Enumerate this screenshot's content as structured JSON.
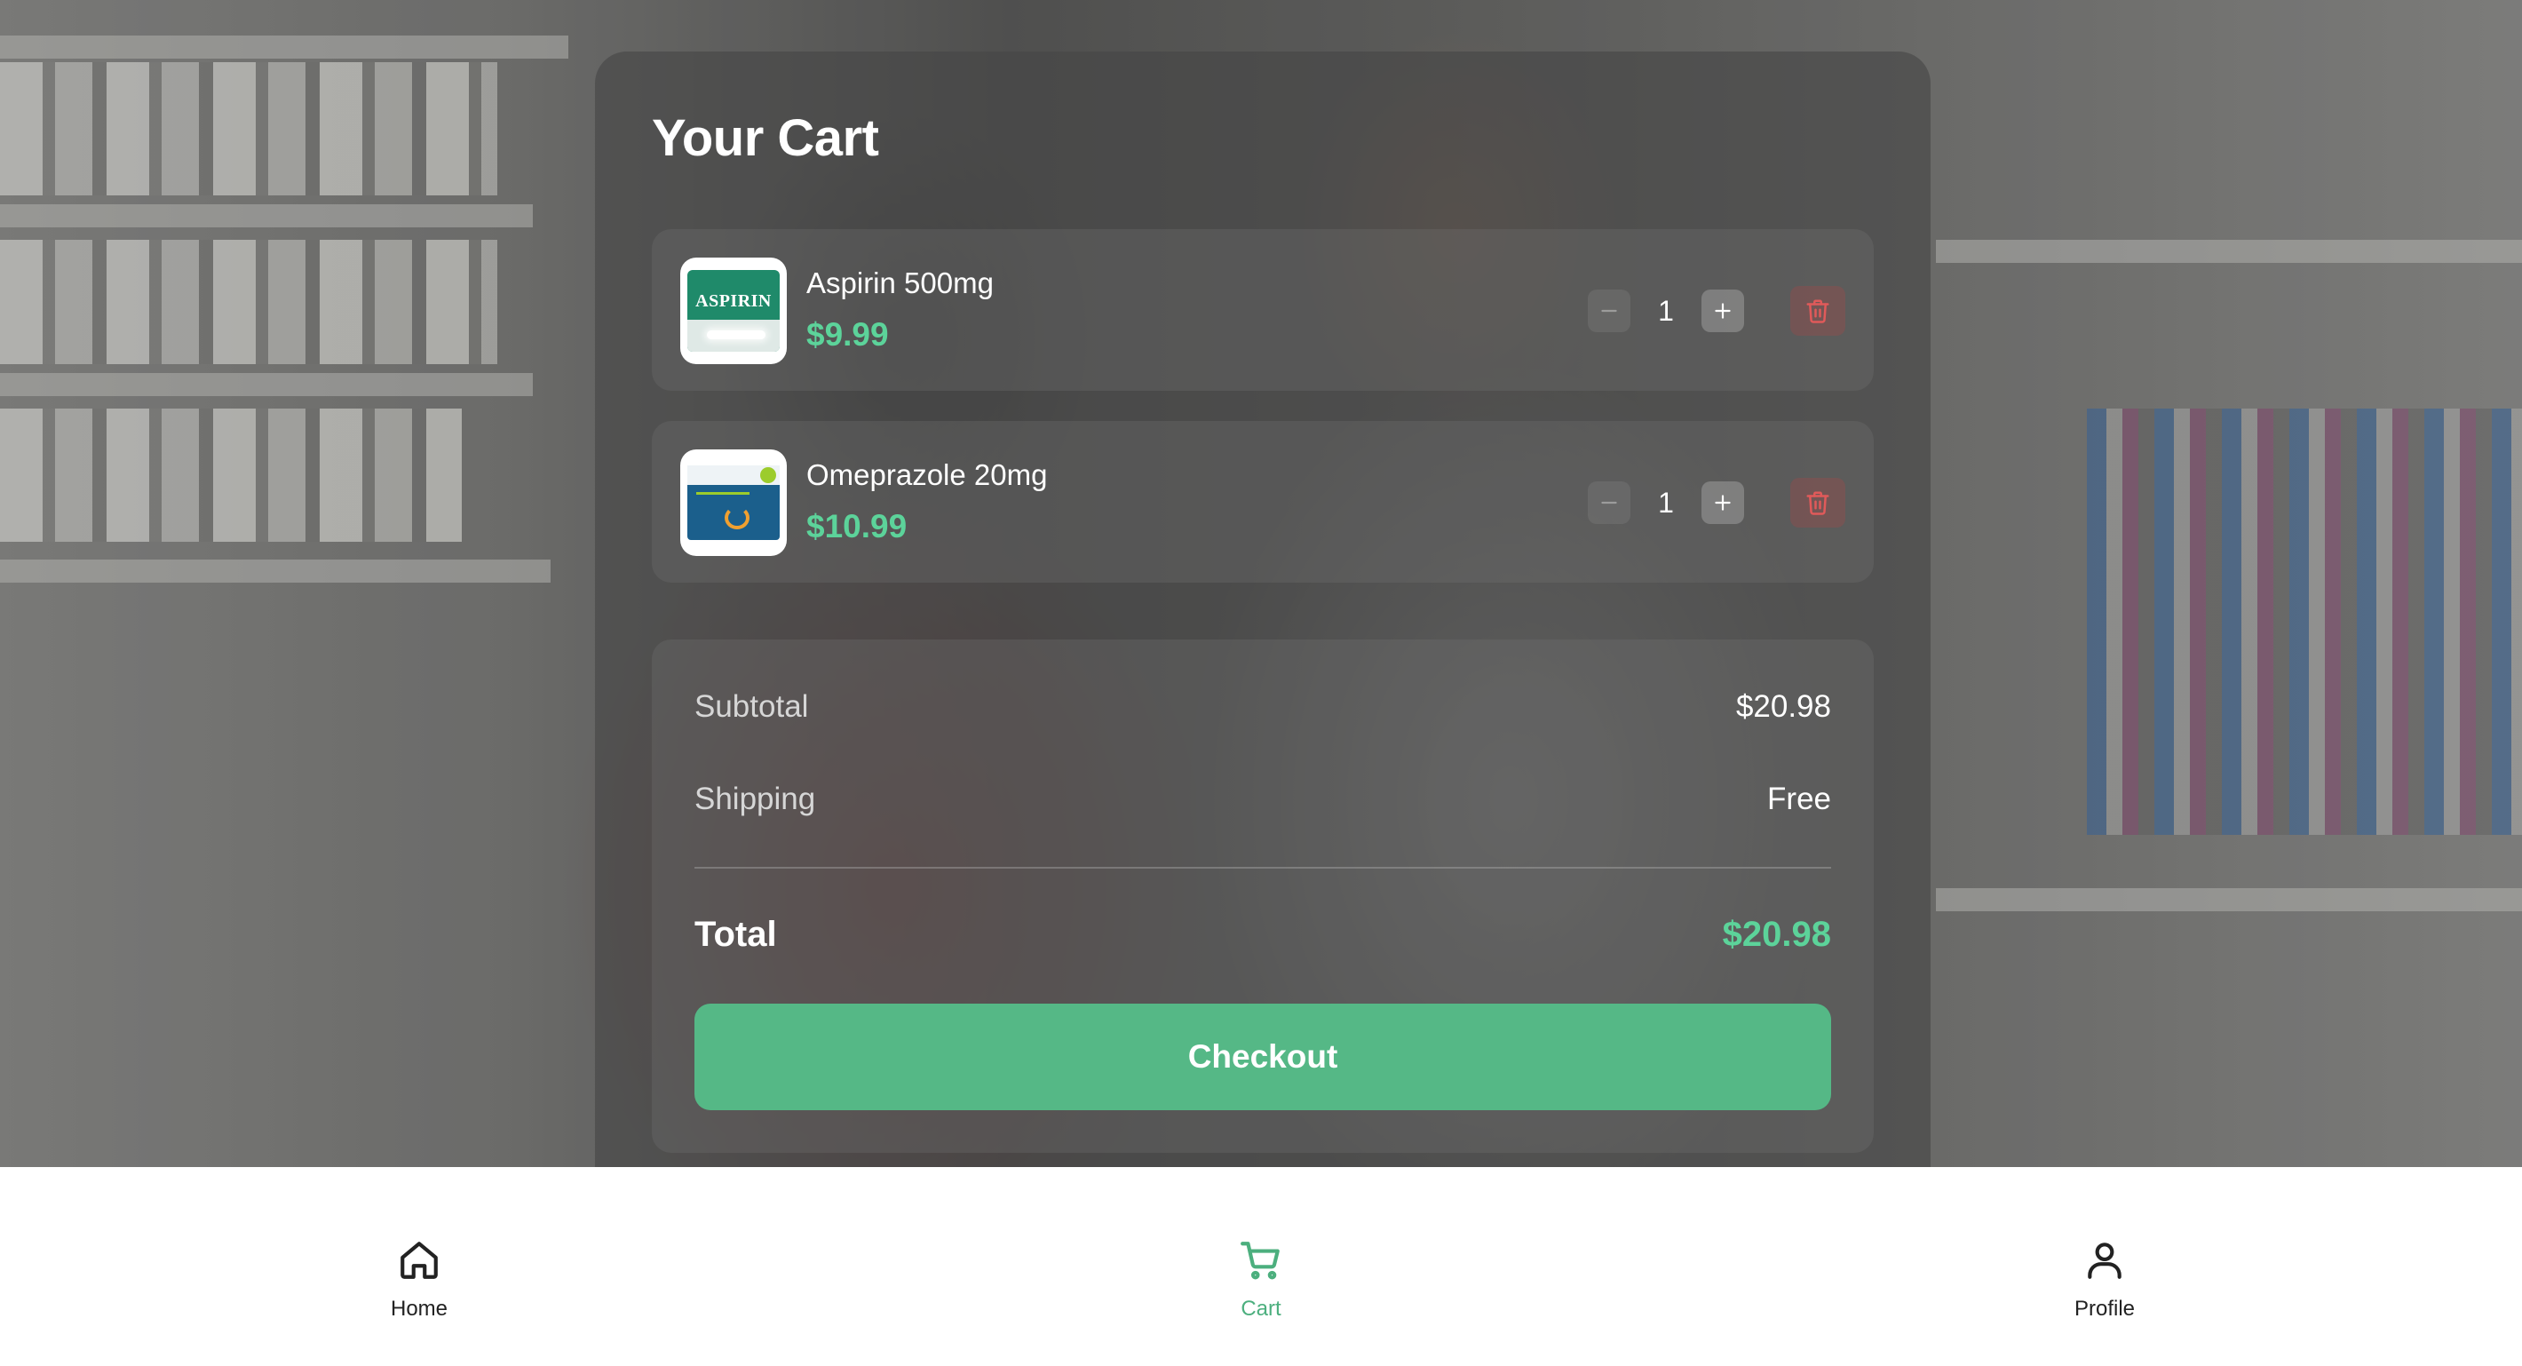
{
  "cart": {
    "title": "Your Cart",
    "items": [
      {
        "name": "Aspirin 500mg",
        "price": "$9.99",
        "quantity": "1",
        "image_icon": "aspirin-package-image",
        "package_brand_text": "ASPIRIN"
      },
      {
        "name": "Omeprazole 20mg",
        "price": "$10.99",
        "quantity": "1",
        "image_icon": "omeprazole-package-image"
      }
    ]
  },
  "summary": {
    "subtotal_label": "Subtotal",
    "subtotal_value": "$20.98",
    "shipping_label": "Shipping",
    "shipping_value": "Free",
    "total_label": "Total",
    "total_value": "$20.98",
    "checkout_label": "Checkout"
  },
  "nav": {
    "items": [
      {
        "label": "Home",
        "icon": "home-icon",
        "active": false
      },
      {
        "label": "Cart",
        "icon": "cart-icon",
        "active": true
      },
      {
        "label": "Profile",
        "icon": "profile-icon",
        "active": false
      }
    ]
  },
  "colors": {
    "accent": "#55b886",
    "price": "#5cd39a",
    "nav_active": "#4caf7e",
    "nav_inactive": "#222222",
    "delete": "#e05a5a"
  }
}
